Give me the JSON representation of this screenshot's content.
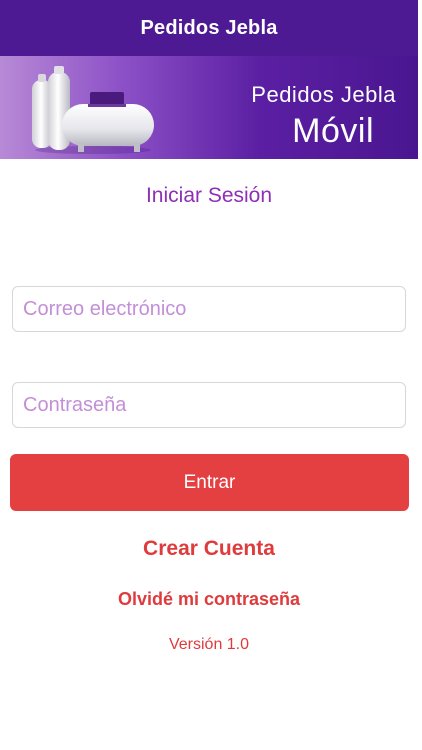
{
  "navbar": {
    "title": "Pedidos Jebla"
  },
  "banner": {
    "line1": "Pedidos Jebla",
    "line2": "Móvil",
    "image_icon": "gas-tanks-icon"
  },
  "login": {
    "title": "Iniciar Sesión",
    "email_placeholder": "Correo electrónico",
    "email_value": "",
    "password_placeholder": "Contraseña",
    "password_value": "",
    "submit_label": "Entrar"
  },
  "links": {
    "create_account": "Crear Cuenta",
    "forgot_password": "Olvidé mi contraseña"
  },
  "footer": {
    "version": "Versión 1.0"
  },
  "colors": {
    "navbar": "#4d1a94",
    "title_purple": "#8e2fb8",
    "placeholder": "#c38fd6",
    "accent_red": "#e43f41"
  }
}
